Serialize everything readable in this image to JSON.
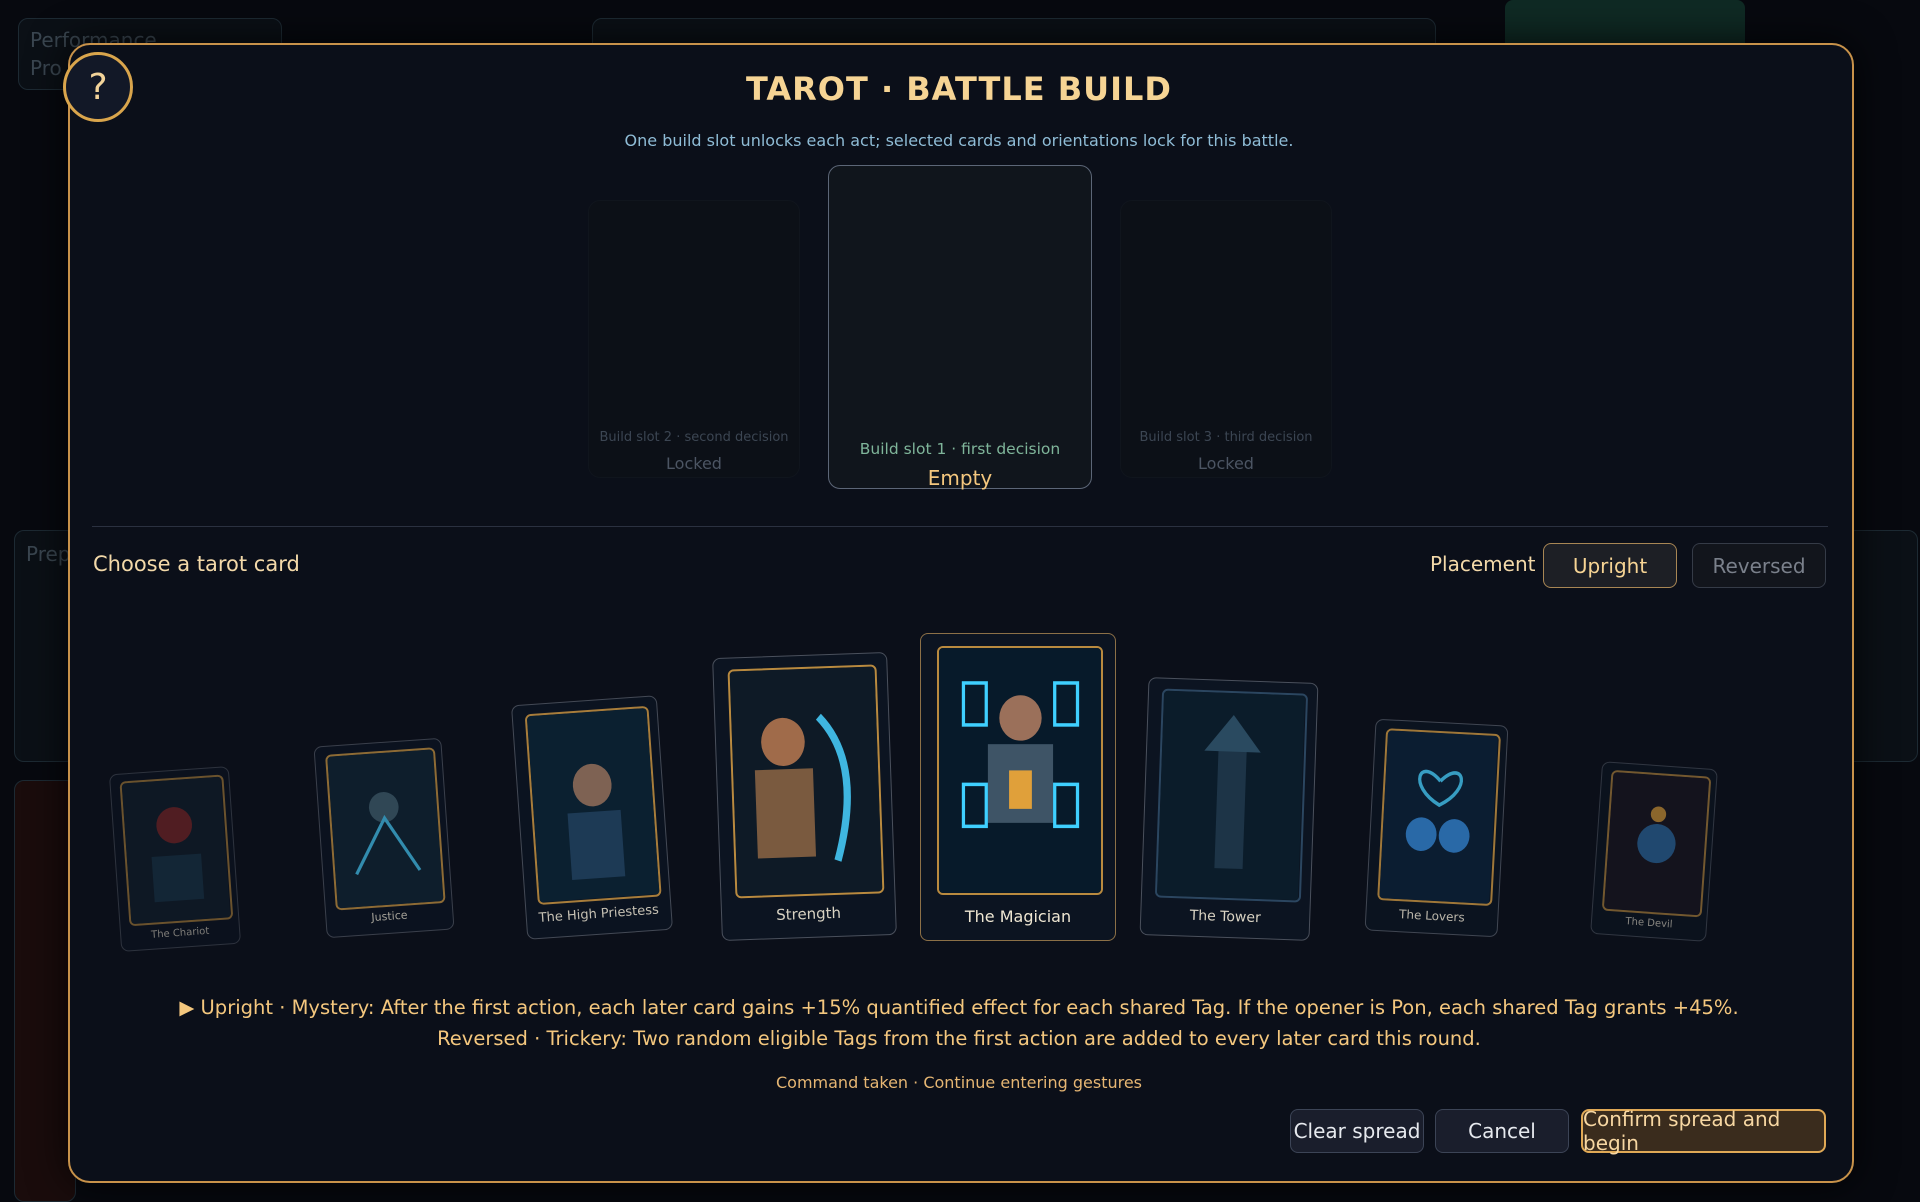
{
  "background": {
    "panel_text_1": "Performance",
    "panel_text_2": "Pro",
    "panel_text_3": "Prep"
  },
  "help": {
    "label": "?"
  },
  "header": {
    "title": "TAROT · BATTLE BUILD",
    "subtitle": "One build slot unlocks each act; selected cards and orientations lock for this battle."
  },
  "slots": [
    {
      "label": "Build slot 2 · second decision",
      "state": "Locked"
    },
    {
      "label": "Build slot 1 · first decision",
      "state": "Empty"
    },
    {
      "label": "Build slot 3 · third decision",
      "state": "Locked"
    }
  ],
  "picker": {
    "heading": "Choose a tarot card",
    "placement_label": "Placement",
    "upright_label": "Upright",
    "reversed_label": "Reversed",
    "selected_orientation": "Upright"
  },
  "cards": [
    {
      "name": "The Chariot"
    },
    {
      "name": "Justice"
    },
    {
      "name": "The High Priestess"
    },
    {
      "name": "Strength"
    },
    {
      "name": "The Magician",
      "selected": true
    },
    {
      "name": "The Tower"
    },
    {
      "name": "The Lovers"
    },
    {
      "name": "The Devil"
    }
  ],
  "description": {
    "upright": "▶ Upright · Mystery: After the first action, each later card gains +15% quantified effect for each shared Tag. If the opener is Pon, each shared Tag grants +45%.",
    "reversed": "Reversed · Trickery: Two random eligible Tags from the first action are added to every later card this round."
  },
  "status": "Command taken · Continue entering gestures",
  "footer": {
    "clear_label": "Clear spread",
    "cancel_label": "Cancel",
    "confirm_label": "Confirm spread and begin"
  },
  "colors": {
    "accent_gold": "#c8924a",
    "title_gold": "#f6d494",
    "subtitle_blue": "#8fbcd6",
    "modal_bg": "#0b0f19"
  }
}
